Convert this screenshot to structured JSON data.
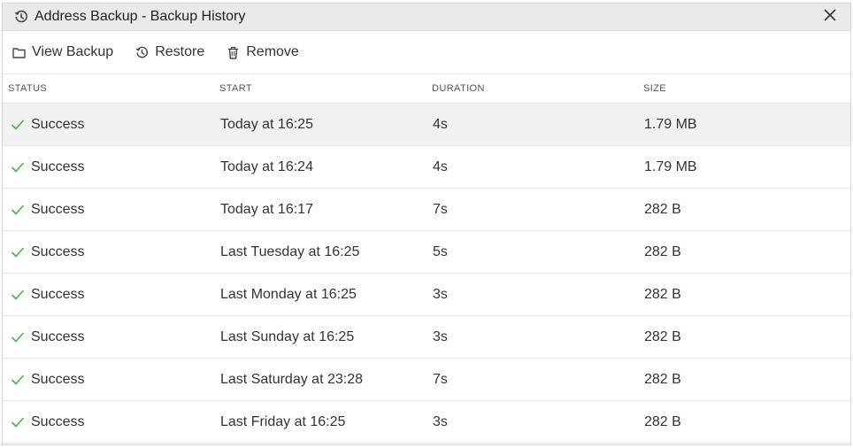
{
  "window": {
    "title": "Address Backup - Backup History",
    "title_icon": "history-icon",
    "close_icon": "close-icon"
  },
  "toolbar": {
    "view_label": "View Backup",
    "view_icon": "folder-icon",
    "restore_label": "Restore",
    "restore_icon": "history-icon",
    "remove_label": "Remove",
    "remove_icon": "trash-icon"
  },
  "table": {
    "headers": {
      "status": "STATUS",
      "start": "START",
      "duration": "DURATION",
      "size": "SIZE"
    },
    "rows": [
      {
        "status": "Success",
        "start": "Today at 16:25",
        "duration": "4s",
        "size": "1.79 MB"
      },
      {
        "status": "Success",
        "start": "Today at 16:24",
        "duration": "4s",
        "size": "1.79 MB"
      },
      {
        "status": "Success",
        "start": "Today at 16:17",
        "duration": "7s",
        "size": "282 B"
      },
      {
        "status": "Success",
        "start": "Last Tuesday at 16:25",
        "duration": "5s",
        "size": "282 B"
      },
      {
        "status": "Success",
        "start": "Last Monday at 16:25",
        "duration": "3s",
        "size": "282 B"
      },
      {
        "status": "Success",
        "start": "Last Sunday at 16:25",
        "duration": "3s",
        "size": "282 B"
      },
      {
        "status": "Success",
        "start": "Last Saturday at 23:28",
        "duration": "7s",
        "size": "282 B"
      },
      {
        "status": "Success",
        "start": "Last Friday at 16:25",
        "duration": "3s",
        "size": "282 B"
      }
    ],
    "selected_index": 0
  },
  "colors": {
    "success": "#4caf50",
    "titlebar_bg": "#eaeaea",
    "selected_row_bg": "#f1f1f1"
  }
}
